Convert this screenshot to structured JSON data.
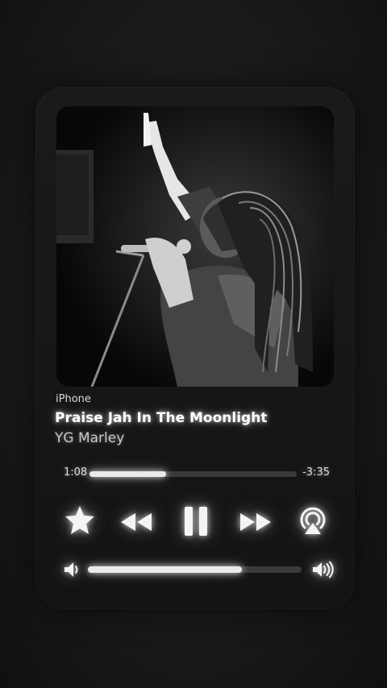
{
  "player": {
    "source": "iPhone",
    "title": "Praise Jah In The Moonlight",
    "artist": "YG Marley",
    "elapsed": "1:08",
    "remaining": "-3:35",
    "progress_fraction": 0.37,
    "volume_fraction": 0.72
  },
  "icons": {
    "favorite": "star-icon",
    "previous": "rewind-icon",
    "playpause": "pause-icon",
    "next": "fast-forward-icon",
    "output": "airplay-icon",
    "volume_min": "speaker-low-icon",
    "volume_max": "speaker-high-icon"
  },
  "colors": {
    "glow": "#ffffff",
    "track": "#3a3a3a",
    "background": "#141414"
  }
}
